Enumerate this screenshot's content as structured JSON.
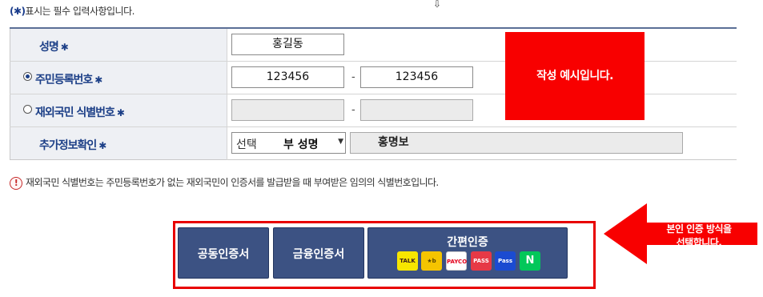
{
  "required_note": {
    "mark": "(✱)",
    "text": "표시는 필수 입력사항입니다."
  },
  "form": {
    "name": {
      "label": "성명",
      "value": "홍길동"
    },
    "resident_id": {
      "label": "주민등록번호",
      "selected": true,
      "front": "123456",
      "back": "123456",
      "separator": "-"
    },
    "foreign_id": {
      "label": "재외국민 식별번호",
      "selected": false,
      "front": "",
      "back": "",
      "separator": "-"
    },
    "extra_info": {
      "label": "추가정보확인",
      "select_placeholder": "선택",
      "select_value": "부 성명",
      "value": "홍명보"
    },
    "required_star": "✱"
  },
  "example_box": {
    "text": "작성 예시입니다."
  },
  "notice": {
    "icon": "exclamation-icon",
    "text": "재외국민 식별번호는 주민등록번호가 없는 재외국민이 인증서를 발급받을 때 부여받은 임의의 식별번호입니다."
  },
  "auth_buttons": {
    "joint_cert": "공동인증서",
    "financial_cert": "금융인증서",
    "simple_auth": "간편인증",
    "providers": [
      {
        "name": "kakao",
        "label": "TALK",
        "bg": "#f7e600",
        "fg": "#3a1d1d"
      },
      {
        "name": "kb",
        "label": "★b",
        "bg": "#f5c400",
        "fg": "#5a4500"
      },
      {
        "name": "payco",
        "label": "PAYCO",
        "bg": "#ffffff",
        "fg": "#e3001b"
      },
      {
        "name": "pass",
        "label": "PASS",
        "bg": "#e63946",
        "fg": "#ffffff"
      },
      {
        "name": "samsung-pass",
        "label": "Pass",
        "bg": "#1b4bd1",
        "fg": "#ffffff"
      },
      {
        "name": "naver",
        "label": "N",
        "bg": "#03c75a",
        "fg": "#ffffff"
      }
    ]
  },
  "callout": {
    "line1": "본인 인증 방식을",
    "line2": "선택합니다.",
    "color": "#f80000"
  },
  "colors": {
    "header_border": "#5b6f96",
    "label_text": "#1c3f87",
    "button_bg": "#3c5283",
    "highlight_red": "#e80000"
  }
}
